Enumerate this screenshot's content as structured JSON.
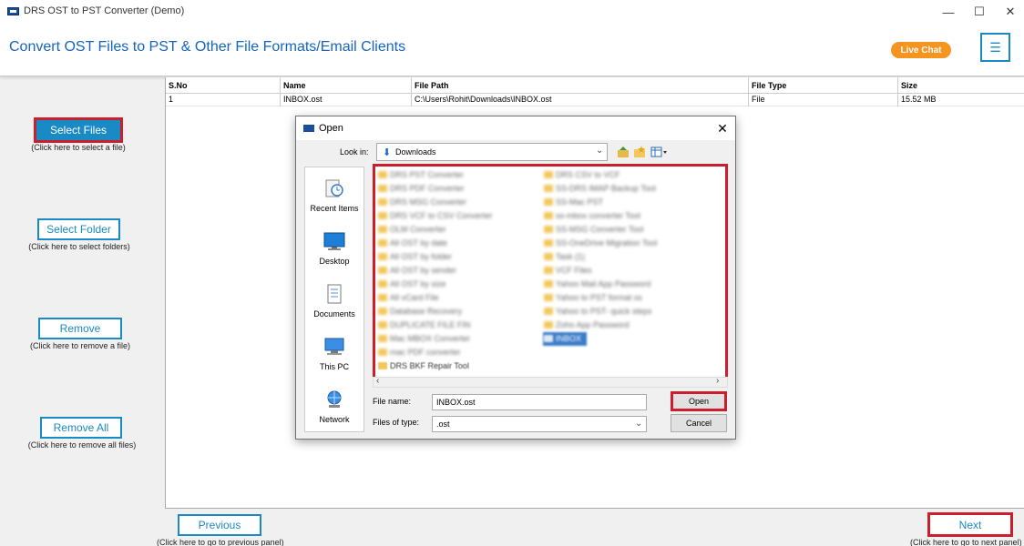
{
  "window": {
    "title": "DRS OST to PST Converter (Demo)",
    "icons": [
      "app-icon",
      "minimize-icon",
      "maximize-icon",
      "close-icon"
    ]
  },
  "header": {
    "title": "Convert OST Files to PST & Other File Formats/Email Clients",
    "live_chat": "Live Chat",
    "menu_icon": "hamburger-menu-icon"
  },
  "sidebar": {
    "select_files": "Select Files",
    "select_files_hint": "(Click here to select a file)",
    "select_folder": "Select Folder",
    "select_folder_hint": "(Click here to select folders)",
    "remove": "Remove",
    "remove_hint": "(Click here to remove a file)",
    "remove_all": "Remove All",
    "remove_all_hint": "(Click here to remove all files)"
  },
  "table": {
    "headers": [
      "S.No",
      "Name",
      "File Path",
      "File Type",
      "Size"
    ],
    "rows": [
      [
        "1",
        "INBOX.ost",
        "C:\\Users\\Rohit\\Downloads\\INBOX.ost",
        "File",
        "15.52 MB"
      ]
    ]
  },
  "navigation": {
    "previous": "Previous",
    "previous_hint": "(Click here to go to previous panel)",
    "next": "Next",
    "next_hint": "(Click here to go to next panel)"
  },
  "dialog": {
    "title": "Open",
    "look_in_label": "Look in:",
    "look_in_value": "Downloads",
    "places": [
      "Recent Items",
      "Desktop",
      "Documents",
      "This PC",
      "Network"
    ],
    "files_left": [
      "DRS PST Converter",
      "DRS PDF Converter",
      "DRS MSG Converter",
      "DRS VCF to CSV Converter",
      "OLM Converter",
      "All OST by date",
      "All OST by folder",
      "All OST by sender",
      "All OST by size",
      "All vCard File",
      "Database Recovery",
      "DUPLICATE FILE FIN",
      "Mac MBOX Converter",
      "mac PDF converter",
      "DRS BKF Repair Tool"
    ],
    "files_right": [
      "DRS CSV to VCF",
      "SS-DRS IMAP Backup Tool",
      "SS-Mac PST",
      "ss-mbox converter Tool",
      "SS-MSG Converter Tool",
      "SS-OneDrive Migration Tool",
      "Task (1)",
      "VCF Files",
      "Yahoo Mail App Password",
      "Yahoo to PST format ss",
      "Yahoo to PST- quick steps",
      "Zoho App Password",
      "INBOX"
    ],
    "file_name_label": "File name:",
    "file_name_value": "INBOX.ost",
    "file_type_label": "Files of type:",
    "file_type_value": ".ost",
    "open_button": "Open",
    "cancel_button": "Cancel"
  },
  "colors": {
    "accent": "#1a8ac4",
    "highlight": "#cc1f2d",
    "live_chat": "#f5941e",
    "title_blue": "#1565c0"
  }
}
